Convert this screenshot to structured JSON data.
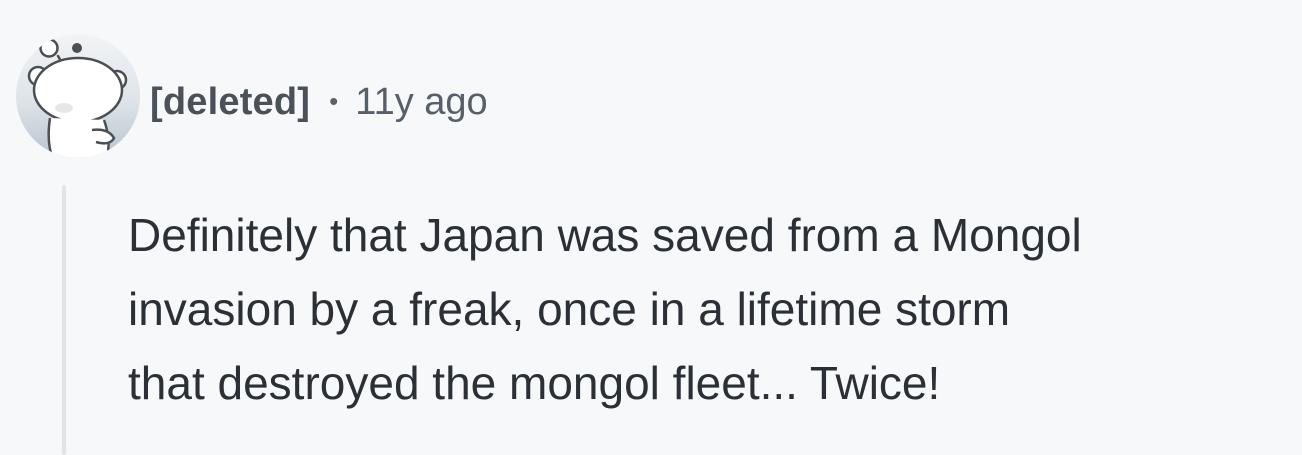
{
  "comment": {
    "author": "[deleted]",
    "separator": "•",
    "timestamp": "11y ago",
    "avatar_icon": "reddit-snoo-default-avatar-icon",
    "body_lines": [
      "Definitely that Japan was saved from a Mongol",
      "invasion by a freak, once in a lifetime storm",
      "that destroyed the mongol fleet... Twice!"
    ]
  },
  "colors": {
    "background": "#f6f8fa",
    "author_text": "#4a5159",
    "meta_text": "#56606a",
    "body_text": "#2a3035",
    "thread_line": "#dfe4ea"
  }
}
